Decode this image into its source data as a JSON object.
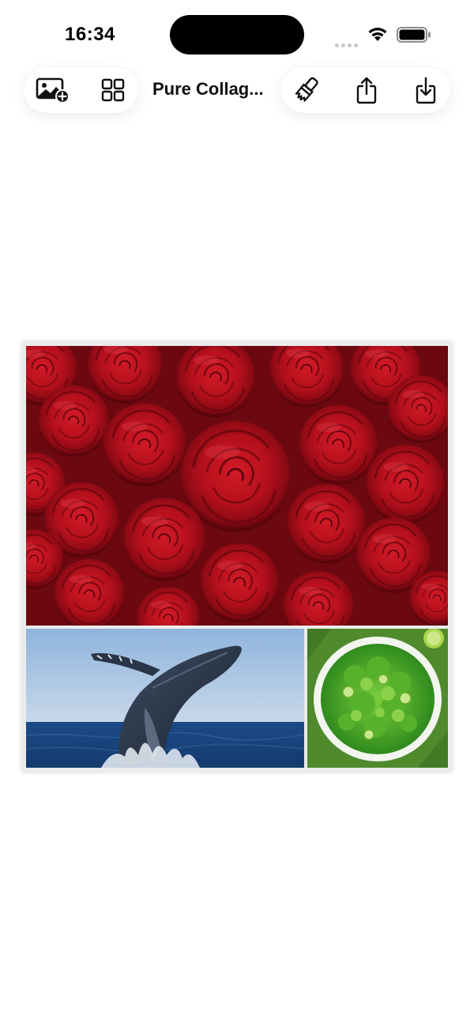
{
  "status_bar": {
    "time": "16:34"
  },
  "toolbar": {
    "title": "Pure Collag...",
    "left_buttons": [
      {
        "name": "add-photo",
        "icon": "photo-add-icon"
      },
      {
        "name": "layout",
        "icon": "grid-icon"
      }
    ],
    "right_buttons": [
      {
        "name": "style",
        "icon": "paintbrush-icon"
      },
      {
        "name": "share",
        "icon": "share-icon"
      },
      {
        "name": "save",
        "icon": "download-icon"
      }
    ]
  },
  "collage": {
    "cells": [
      {
        "position": "top",
        "content": "red-roses-photo"
      },
      {
        "position": "bottom-left",
        "content": "whale-breaching-photo"
      },
      {
        "position": "bottom-right",
        "content": "green-salad-photo"
      }
    ]
  },
  "colors": {
    "background": "#ffffff",
    "icon": "#111111",
    "collage_border": "#ececec",
    "rose_red": "#b5101c",
    "sky_blue": "#a9c6e3",
    "ocean_blue": "#1f4f8f",
    "salad_green": "#4f8a2c"
  }
}
